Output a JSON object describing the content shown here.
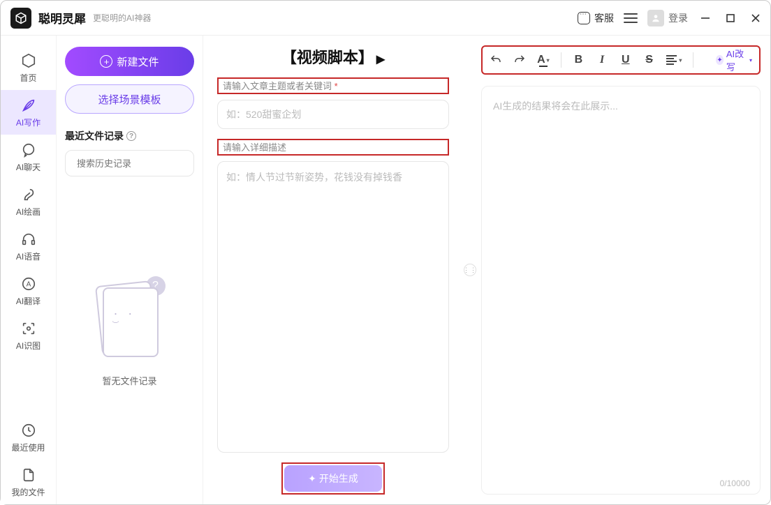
{
  "app": {
    "title": "聪明灵犀",
    "subtitle": "更聪明的AI神器"
  },
  "titlebar": {
    "kefu": "客服",
    "login": "登录"
  },
  "sidebar": {
    "items": [
      {
        "label": "首页"
      },
      {
        "label": "AI写作",
        "active": true
      },
      {
        "label": "AI聊天"
      },
      {
        "label": "AI绘画"
      },
      {
        "label": "AI语音"
      },
      {
        "label": "AI翻译"
      },
      {
        "label": "AI识图"
      }
    ],
    "bottom": [
      {
        "label": "最近使用"
      },
      {
        "label": "我的文件"
      }
    ]
  },
  "leftpanel": {
    "new_file": "新建文件",
    "choose_template": "选择场景模板",
    "recent_header": "最近文件记录",
    "search_placeholder": "搜索历史记录",
    "empty_text": "暂无文件记录"
  },
  "mid": {
    "title": "【视频脚本】",
    "label1": "请输入文章主题或者关键词",
    "required_mark": "*",
    "placeholder1": "如：520甜蜜企划",
    "label2": "请输入详细描述",
    "placeholder2": "如：情人节过节新姿势，花钱没有掉钱香",
    "generate_label": "开始生成"
  },
  "right": {
    "ai_rewrite": "AI改写",
    "result_placeholder": "AI生成的结果将会在此展示...",
    "counter": "0/10000"
  }
}
